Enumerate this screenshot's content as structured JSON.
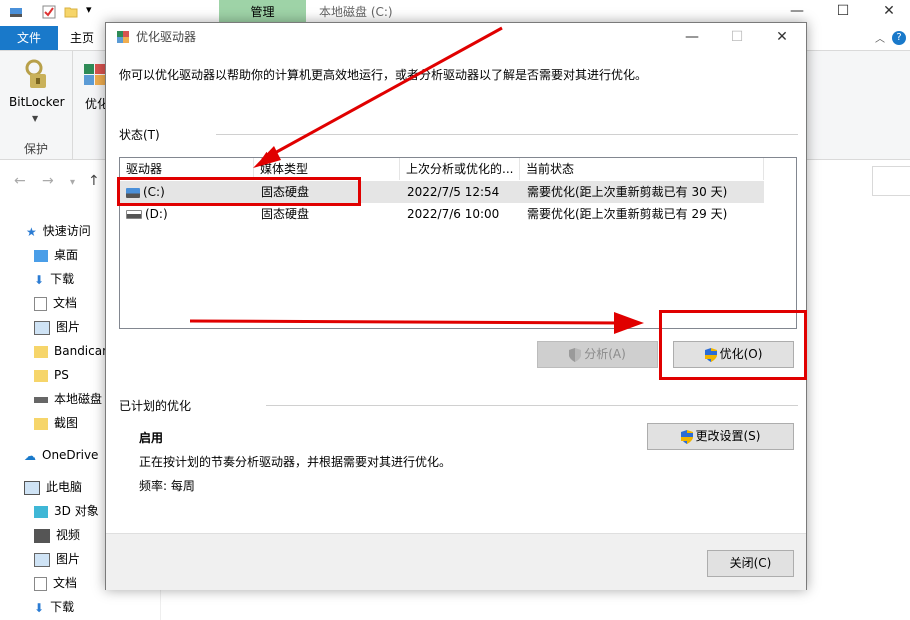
{
  "explorer": {
    "manage_tab": "管理",
    "window_title": "本地磁盘 (C:)",
    "ribbon_tabs": {
      "file": "文件",
      "home": "主页"
    },
    "ribbon": {
      "bitlocker": "BitLocker",
      "protect_group": "保护",
      "optimize_partial": "优化"
    },
    "nav_pane": {
      "items": [
        {
          "label": "快速访问"
        },
        {
          "label": "桌面"
        },
        {
          "label": "下载"
        },
        {
          "label": "文档"
        },
        {
          "label": "图片"
        },
        {
          "label": "Bandican"
        },
        {
          "label": "PS"
        },
        {
          "label": "本地磁盘"
        },
        {
          "label": "截图"
        },
        {
          "label": "OneDrive"
        },
        {
          "label": "此电脑"
        },
        {
          "label": "3D 对象"
        },
        {
          "label": "视频"
        },
        {
          "label": "图片"
        },
        {
          "label": "文档"
        },
        {
          "label": "下载"
        }
      ]
    }
  },
  "dialog": {
    "title": "优化驱动器",
    "intro": "你可以优化驱动器以帮助你的计算机更高效地运行，或者分析驱动器以了解是否需要对其进行优化。",
    "status_label": "状态(T)",
    "columns": [
      "驱动器",
      "媒体类型",
      "上次分析或优化的...",
      "当前状态"
    ],
    "drives": [
      {
        "drive": "(C:)",
        "media": "固态硬盘",
        "last": "2022/7/5 12:54",
        "status": "需要优化(距上次重新剪裁已有 30 天)"
      },
      {
        "drive": "(D:)",
        "media": "固态硬盘",
        "last": "2022/7/6 10:00",
        "status": "需要优化(距上次重新剪裁已有 29 天)"
      }
    ],
    "analyze_button": "分析(A)",
    "optimize_button": "优化(O)",
    "scheduled_label": "已计划的优化",
    "scheduled_status": "启用",
    "scheduled_desc": "正在按计划的节奏分析驱动器，并根据需要对其进行优化。",
    "frequency": "频率: 每周",
    "change_settings_button": "更改设置(S)",
    "close_button": "关闭(C)"
  },
  "colors": {
    "annotation_red": "#e00000",
    "selected_row": "#e5e5e5",
    "file_tab_blue": "#1979ca",
    "manage_tab_green": "#9ed3a7"
  }
}
